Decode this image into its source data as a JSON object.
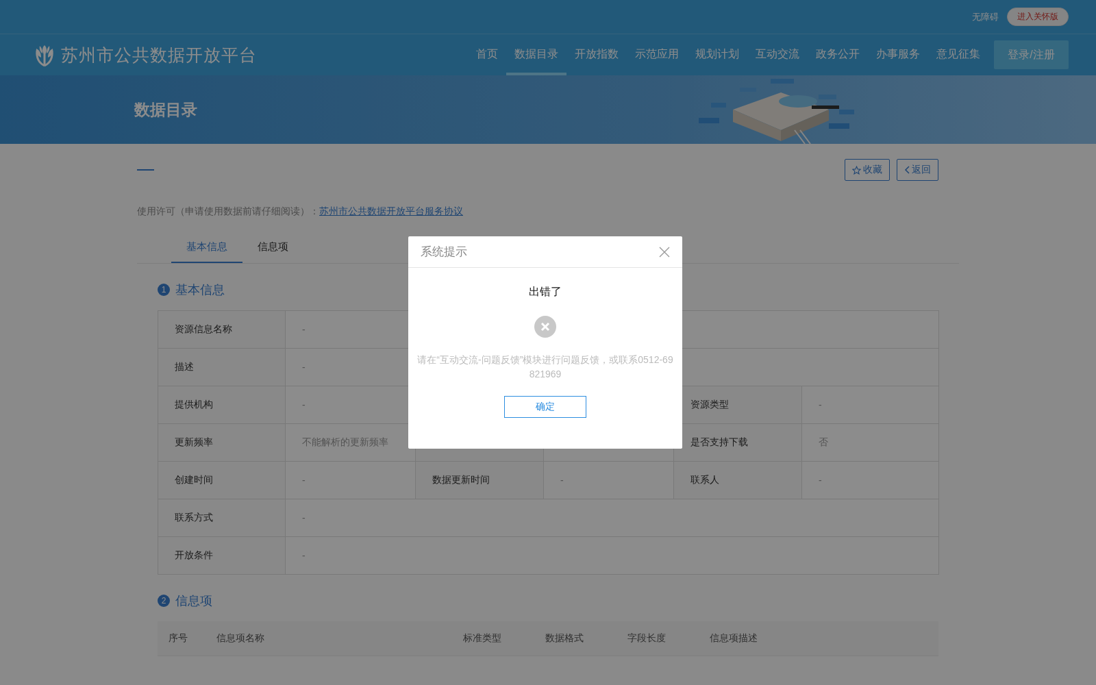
{
  "top_bar": {
    "accessibility_link": "无障碍",
    "care_button": "进入关怀版"
  },
  "header": {
    "logo_text": "苏州市公共数据开放平台",
    "nav": [
      {
        "label": "首页",
        "selected": false
      },
      {
        "label": "数据目录",
        "selected": true
      },
      {
        "label": "开放指数",
        "selected": false
      },
      {
        "label": "示范应用",
        "selected": false
      },
      {
        "label": "规划计划",
        "selected": false
      },
      {
        "label": "互动交流",
        "selected": false
      },
      {
        "label": "政务公开",
        "selected": false
      },
      {
        "label": "办事服务",
        "selected": false
      },
      {
        "label": "意见征集",
        "selected": false
      }
    ],
    "login_button": "登录/注册"
  },
  "banner": {
    "title": "数据目录"
  },
  "actions": [
    {
      "kind": "favorite",
      "label": "收藏"
    },
    {
      "kind": "back",
      "label": "返回"
    }
  ],
  "license": {
    "label": "使用许可（申请使用数据前请仔细阅读）：",
    "link": "苏州市公共数据开放平台服务协议"
  },
  "tabs": [
    {
      "label": "基本信息",
      "selected": true
    },
    {
      "label": "信息项",
      "selected": false
    }
  ],
  "basic_info": {
    "number": "1",
    "title": "基本信息",
    "rows": [
      [
        {
          "label": "资源信息名称",
          "value": "-"
        }
      ],
      [
        {
          "label": "描述",
          "value": "-"
        }
      ],
      [
        {
          "label": "提供机构",
          "value": "-"
        },
        {},
        {
          "label": "资源类型",
          "value": "-"
        }
      ],
      [
        {
          "label": "更新频率",
          "value": "不能解析的更新频率"
        },
        {},
        {
          "label": "是否支持下载",
          "value": "否"
        }
      ],
      [
        {
          "label": "创建时间",
          "value": "-"
        },
        {
          "label": "数据更新时间",
          "value": "-"
        },
        {
          "label": "联系人",
          "value": "-"
        }
      ],
      [
        {
          "label": "联系方式",
          "value": "-"
        }
      ],
      [
        {
          "label": "开放条件",
          "value": "-"
        }
      ]
    ]
  },
  "info_items": {
    "number": "2",
    "title": "信息项",
    "columns": [
      "序号",
      "信息项名称",
      "标准类型",
      "数据格式",
      "字段长度",
      "信息项描述"
    ]
  },
  "dialog": {
    "title": "系统提示",
    "heading": "出错了",
    "message": "请在“互动交流-问题反馈”模块进行问题反馈，或联系0512-69821969",
    "confirm_button": "确定"
  }
}
